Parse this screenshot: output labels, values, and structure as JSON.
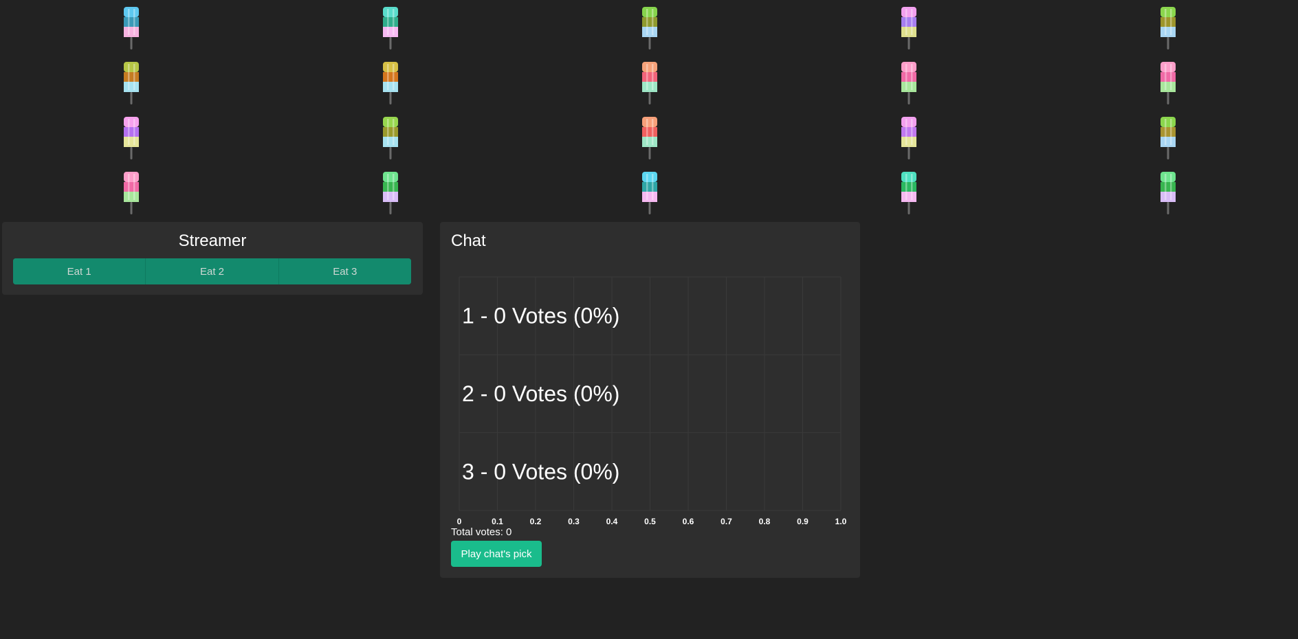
{
  "popsicles": [
    {
      "layers": [
        "#5ec8f0",
        "#3a9ab8",
        "#f7b3e0"
      ]
    },
    {
      "layers": [
        "#59dccb",
        "#2fae8c",
        "#f6b9f1"
      ]
    },
    {
      "layers": [
        "#86d44c",
        "#8f9a2e",
        "#a9d6f3"
      ]
    },
    {
      "layers": [
        "#f3a0ef",
        "#a77ef0",
        "#dfe08e"
      ]
    },
    {
      "layers": [
        "#8bd64d",
        "#9d952c",
        "#a9d6f3"
      ]
    },
    {
      "layers": [
        "#b6c646",
        "#c67c22",
        "#a7e2f0"
      ]
    },
    {
      "layers": [
        "#d6bf45",
        "#d4761e",
        "#a7e2f0"
      ]
    },
    {
      "layers": [
        "#f6a27a",
        "#f2647a",
        "#9ee6c6"
      ]
    },
    {
      "layers": [
        "#fc9ec9",
        "#f06aa6",
        "#a8e69c"
      ]
    },
    {
      "layers": [
        "#fc9ec9",
        "#f06aa6",
        "#a8e69c"
      ]
    },
    {
      "layers": [
        "#f7a2ee",
        "#b570f0",
        "#e5e59a"
      ]
    },
    {
      "layers": [
        "#97d64e",
        "#9a9a2c",
        "#a7e2f0"
      ]
    },
    {
      "layers": [
        "#f7a07a",
        "#f0605e",
        "#9ee6c6"
      ]
    },
    {
      "layers": [
        "#f3a0ef",
        "#c179f0",
        "#e5e59a"
      ]
    },
    {
      "layers": [
        "#8bd64d",
        "#a99430",
        "#a9d6f3"
      ]
    },
    {
      "layers": [
        "#fc9ec9",
        "#f06aa6",
        "#a8e69c"
      ]
    },
    {
      "layers": [
        "#6ee48e",
        "#38b650",
        "#d9bdf7"
      ]
    },
    {
      "layers": [
        "#5bd6f0",
        "#2ea6a6",
        "#f6b9f1"
      ]
    },
    {
      "layers": [
        "#4ee0c0",
        "#2ab860",
        "#f6b9f1"
      ]
    },
    {
      "layers": [
        "#6ee48e",
        "#38b650",
        "#d9bdf7"
      ]
    }
  ],
  "streamer": {
    "title": "Streamer",
    "buttons": [
      "Eat 1",
      "Eat 2",
      "Eat 3"
    ]
  },
  "chat": {
    "title": "Chat",
    "total_votes": "Total votes: 0",
    "play_button": "Play chat's pick"
  },
  "chart_data": {
    "type": "bar",
    "orientation": "horizontal",
    "categories": [
      "1",
      "2",
      "3"
    ],
    "values": [
      0,
      0,
      0
    ],
    "bar_labels": [
      "1 - 0 Votes (0%)",
      "2 - 0 Votes (0%)",
      "3 - 0 Votes (0%)"
    ],
    "xlim": [
      0,
      1.0
    ],
    "x_ticks": [
      "0",
      "0.1",
      "0.2",
      "0.3",
      "0.4",
      "0.5",
      "0.6",
      "0.7",
      "0.8",
      "0.9",
      "1.0"
    ],
    "grid": true,
    "bar_color": "#138a6d"
  }
}
